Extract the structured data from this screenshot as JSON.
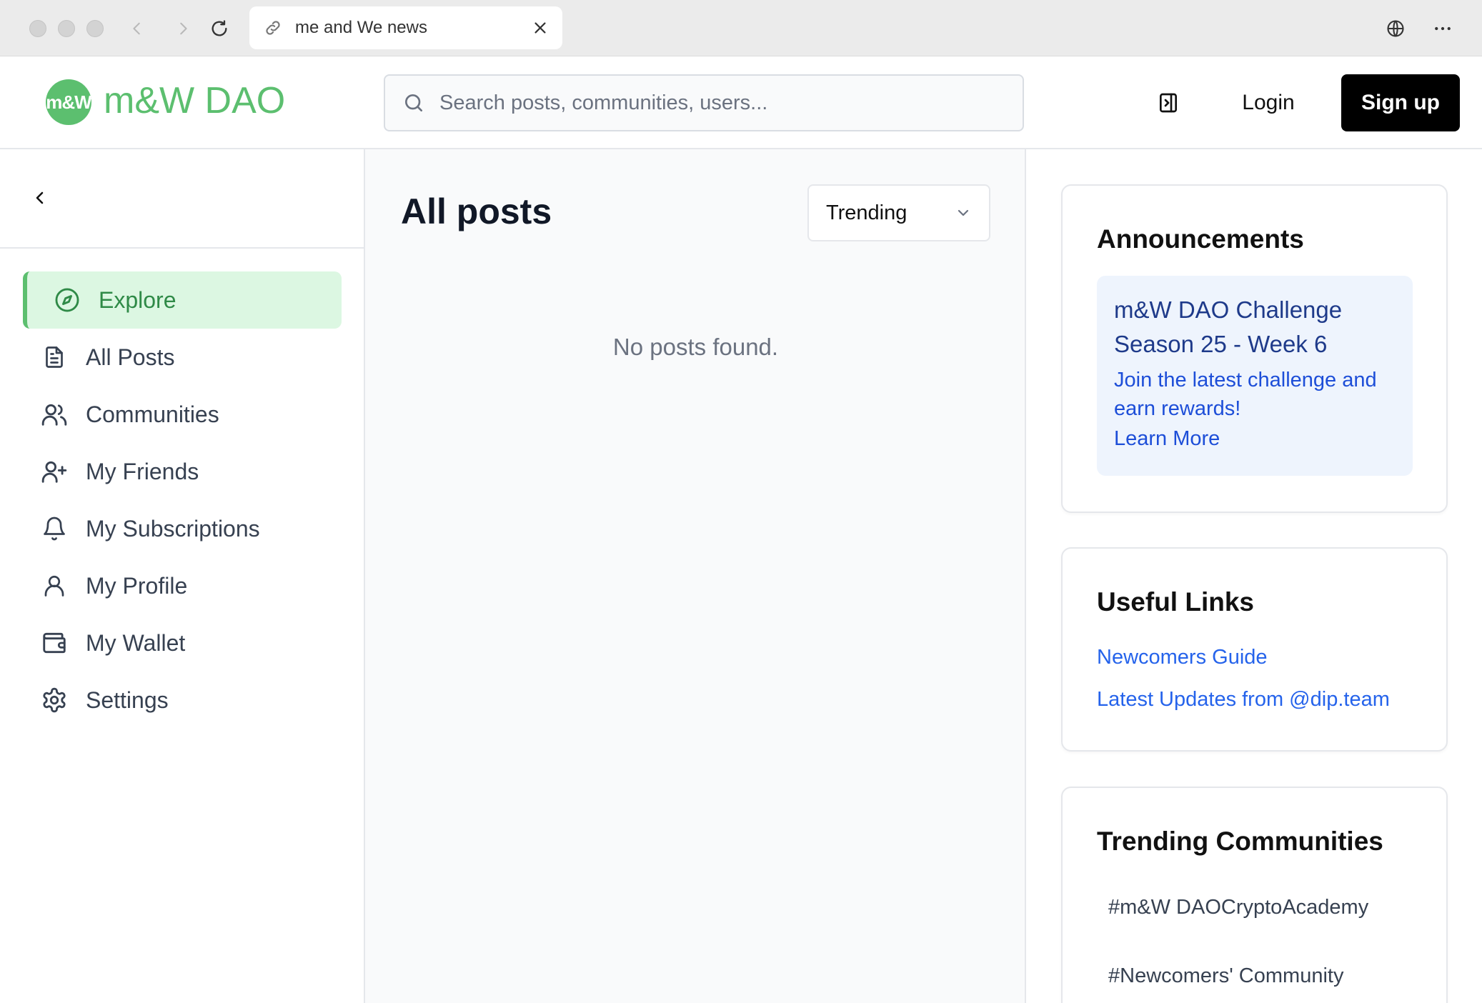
{
  "browser": {
    "tab_title": "me and We news"
  },
  "header": {
    "logo_mark": "m&W",
    "logo_text": "m&W DAO",
    "search_placeholder": "Search posts, communities, users...",
    "login_label": "Login",
    "signup_label": "Sign up"
  },
  "sidebar": {
    "items": [
      {
        "label": "Explore",
        "icon": "compass-icon",
        "active": true
      },
      {
        "label": "All Posts",
        "icon": "document-icon"
      },
      {
        "label": "Communities",
        "icon": "users-icon"
      },
      {
        "label": "My Friends",
        "icon": "user-plus-icon"
      },
      {
        "label": "My Subscriptions",
        "icon": "bell-icon"
      },
      {
        "label": "My Profile",
        "icon": "user-icon"
      },
      {
        "label": "My Wallet",
        "icon": "wallet-icon"
      },
      {
        "label": "Settings",
        "icon": "gear-icon"
      }
    ]
  },
  "main": {
    "title": "All posts",
    "sort_value": "Trending",
    "empty_message": "No posts found."
  },
  "announcements": {
    "title": "Announcements",
    "item_title": "m&W DAO Challenge Season 25 - Week 6",
    "item_text": "Join the latest challenge and earn rewards!",
    "item_link": "Learn More"
  },
  "useful_links": {
    "title": "Useful Links",
    "links": [
      "Newcomers Guide",
      "Latest Updates from @dip.team"
    ]
  },
  "trending_communities": {
    "title": "Trending Communities",
    "items": [
      "#m&W DAOCryptoAcademy",
      "#Newcomers' Community"
    ]
  },
  "colors": {
    "brand": "#5cbf6f",
    "active_bg": "#dcf7e2",
    "link": "#2563eb",
    "announce_bg": "#eef4fd"
  }
}
